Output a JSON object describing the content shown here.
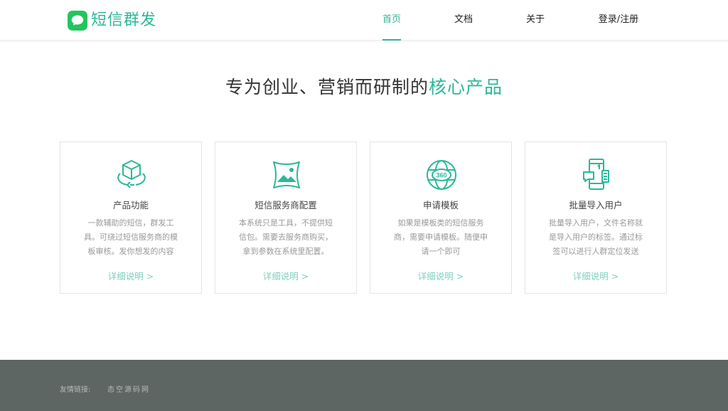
{
  "brand": {
    "name": "短信群发",
    "accent": "#2bb89a"
  },
  "nav": {
    "home": "首页",
    "docs": "文档",
    "about": "关于",
    "login": "登录/注册"
  },
  "headline": {
    "prefix": "专为创业、营销而研制的",
    "highlight": "核心产品"
  },
  "cards": [
    {
      "icon": "cube-rotate-icon",
      "title": "产品功能",
      "desc": "一款辅助的短信，群发工具。可绕过短信服务商的模板审核。发你想发的内容",
      "link": "详细说明 >"
    },
    {
      "icon": "image-frame-icon",
      "title": "短信服务商配置",
      "desc": "本系统只是工具，不提供短信包。需要去服务商购买，拿到参数在系统里配置。",
      "link": "详细说明 >"
    },
    {
      "icon": "globe-360-icon",
      "title": "申请模板",
      "desc": "如果是模板类的短信服务商，需要申请模板。随便申请一个即可",
      "link": "详细说明 >"
    },
    {
      "icon": "phone-import-icon",
      "title": "批量导入用户",
      "desc": "批量导入用户，文件名称就是导入用户的标签。通过标签可以进行人群定位发送",
      "link": "详细说明 >"
    }
  ],
  "footer": {
    "label": "友情链接:",
    "link": "态空源码网"
  }
}
